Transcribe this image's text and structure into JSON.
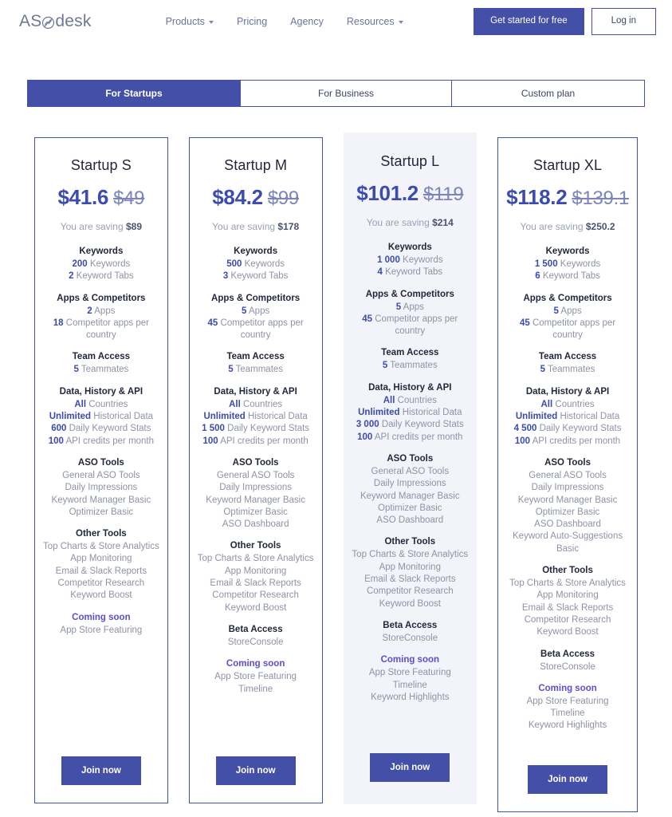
{
  "header": {
    "logo_text_1": "AS",
    "logo_mark": "chart-circle-icon",
    "logo_text_2": "desk",
    "nav": [
      {
        "label": "Products",
        "has_caret": true
      },
      {
        "label": "Pricing",
        "has_caret": false
      },
      {
        "label": "Agency",
        "has_caret": false
      },
      {
        "label": "Resources",
        "has_caret": true
      }
    ],
    "cta_primary": "Get started for free",
    "cta_secondary": "Log in"
  },
  "tabs": [
    {
      "label": "For Startups",
      "active": true
    },
    {
      "label": "For Business",
      "active": false
    },
    {
      "label": "Custom plan",
      "active": false
    }
  ],
  "colors": {
    "accent": "#4450a8",
    "price_new": "#3b4bb0",
    "price_old": "#7b84bd",
    "coming_soon": "#5b4fce",
    "highlight_bg": "#f2f4f9",
    "muted_text": "#8d93a6"
  },
  "cta_label": "Join now",
  "plans": [
    {
      "name": "Startup S",
      "price_new": "$41.6",
      "price_old": "$49",
      "saving_prefix": "You are saving ",
      "saving_amount": "$89",
      "highlight": false,
      "groups": [
        {
          "title": "Keywords",
          "items": [
            {
              "bold": "200",
              "rest": " Keywords"
            },
            {
              "bold": "2",
              "rest": " Keyword Tabs"
            }
          ]
        },
        {
          "title": "Apps & Competitors",
          "items": [
            {
              "bold": "2",
              "rest": " Apps"
            },
            {
              "bold": "18",
              "rest": " Competitor apps per country"
            }
          ]
        },
        {
          "title": "Team Access",
          "items": [
            {
              "bold": "5",
              "rest": " Teammates"
            }
          ]
        },
        {
          "title": "Data, History & API",
          "items": [
            {
              "bold": "All",
              "rest": " Countries"
            },
            {
              "bold": "Unlimited",
              "rest": " Historical Data"
            },
            {
              "bold": "600",
              "rest": " Daily Keyword Stats"
            },
            {
              "bold": "100",
              "rest": " API credits per month"
            }
          ]
        },
        {
          "title": "ASO Tools",
          "items": [
            {
              "bold": "",
              "rest": "General ASO Tools"
            },
            {
              "bold": "",
              "rest": "Daily Impressions"
            },
            {
              "bold": "",
              "rest": "Keyword Manager Basic"
            },
            {
              "bold": "",
              "rest": "Optimizer Basic"
            }
          ]
        },
        {
          "title": "Other Tools",
          "items": [
            {
              "bold": "",
              "rest": "Top Charts & Store Analytics"
            },
            {
              "bold": "",
              "rest": "App Monitoring"
            },
            {
              "bold": "",
              "rest": "Email & Slack Reports"
            },
            {
              "bold": "",
              "rest": "Competitor Research"
            },
            {
              "bold": "",
              "rest": "Keyword Boost"
            }
          ]
        },
        {
          "title": "Coming soon",
          "coming": true,
          "items": [
            {
              "bold": "",
              "rest": "App Store Featuring"
            }
          ]
        }
      ]
    },
    {
      "name": "Startup M",
      "price_new": "$84.2",
      "price_old": "$99",
      "saving_prefix": "You are saving ",
      "saving_amount": "$178",
      "highlight": false,
      "groups": [
        {
          "title": "Keywords",
          "items": [
            {
              "bold": "500",
              "rest": " Keywords"
            },
            {
              "bold": "3",
              "rest": " Keyword Tabs"
            }
          ]
        },
        {
          "title": "Apps & Competitors",
          "items": [
            {
              "bold": "5",
              "rest": " Apps"
            },
            {
              "bold": "45",
              "rest": " Competitor apps per country"
            }
          ]
        },
        {
          "title": "Team Access",
          "items": [
            {
              "bold": "5",
              "rest": " Teammates"
            }
          ]
        },
        {
          "title": "Data, History & API",
          "items": [
            {
              "bold": "All",
              "rest": " Countries"
            },
            {
              "bold": "Unlimited",
              "rest": " Historical Data"
            },
            {
              "bold": "1 500",
              "rest": " Daily Keyword Stats"
            },
            {
              "bold": "100",
              "rest": " API credits per month"
            }
          ]
        },
        {
          "title": "ASO Tools",
          "items": [
            {
              "bold": "",
              "rest": "General ASO Tools"
            },
            {
              "bold": "",
              "rest": "Daily Impressions"
            },
            {
              "bold": "",
              "rest": "Keyword Manager Basic"
            },
            {
              "bold": "",
              "rest": "Optimizer Basic"
            },
            {
              "bold": "",
              "rest": "ASO Dashboard"
            }
          ]
        },
        {
          "title": "Other Tools",
          "items": [
            {
              "bold": "",
              "rest": "Top Charts & Store Analytics"
            },
            {
              "bold": "",
              "rest": "App Monitoring"
            },
            {
              "bold": "",
              "rest": "Email & Slack Reports"
            },
            {
              "bold": "",
              "rest": "Competitor Research"
            },
            {
              "bold": "",
              "rest": "Keyword Boost"
            }
          ]
        },
        {
          "title": "Beta Access",
          "items": [
            {
              "bold": "",
              "rest": "StoreConsole"
            }
          ]
        },
        {
          "title": "Coming soon",
          "coming": true,
          "items": [
            {
              "bold": "",
              "rest": "App Store Featuring"
            },
            {
              "bold": "",
              "rest": "Timeline"
            }
          ]
        }
      ]
    },
    {
      "name": "Startup L",
      "price_new": "$101.2",
      "price_old": "$119",
      "saving_prefix": "You are saving ",
      "saving_amount": "$214",
      "highlight": true,
      "groups": [
        {
          "title": "Keywords",
          "items": [
            {
              "bold": "1 000",
              "rest": " Keywords"
            },
            {
              "bold": "4",
              "rest": " Keyword Tabs"
            }
          ]
        },
        {
          "title": "Apps & Competitors",
          "items": [
            {
              "bold": "5",
              "rest": " Apps"
            },
            {
              "bold": "45",
              "rest": " Competitor apps per country"
            }
          ]
        },
        {
          "title": "Team Access",
          "items": [
            {
              "bold": "5",
              "rest": " Teammates"
            }
          ]
        },
        {
          "title": "Data, History & API",
          "items": [
            {
              "bold": "All",
              "rest": " Countries"
            },
            {
              "bold": "Unlimited",
              "rest": " Historical Data"
            },
            {
              "bold": "3 000",
              "rest": " Daily Keyword Stats"
            },
            {
              "bold": "100",
              "rest": " API credits per month"
            }
          ]
        },
        {
          "title": "ASO Tools",
          "items": [
            {
              "bold": "",
              "rest": "General ASO Tools"
            },
            {
              "bold": "",
              "rest": "Daily Impressions"
            },
            {
              "bold": "",
              "rest": "Keyword Manager Basic"
            },
            {
              "bold": "",
              "rest": "Optimizer Basic"
            },
            {
              "bold": "",
              "rest": "ASO Dashboard"
            }
          ]
        },
        {
          "title": "Other Tools",
          "items": [
            {
              "bold": "",
              "rest": "Top Charts & Store Analytics"
            },
            {
              "bold": "",
              "rest": "App Monitoring"
            },
            {
              "bold": "",
              "rest": "Email & Slack Reports"
            },
            {
              "bold": "",
              "rest": "Competitor Research"
            },
            {
              "bold": "",
              "rest": "Keyword Boost"
            }
          ]
        },
        {
          "title": "Beta Access",
          "items": [
            {
              "bold": "",
              "rest": "StoreConsole"
            }
          ]
        },
        {
          "title": "Coming soon",
          "coming": true,
          "items": [
            {
              "bold": "",
              "rest": "App Store Featuring"
            },
            {
              "bold": "",
              "rest": "Timeline"
            },
            {
              "bold": "",
              "rest": "Keyword Highlights"
            }
          ]
        }
      ]
    },
    {
      "name": "Startup XL",
      "price_new": "$118.2",
      "price_old": "$139.1",
      "saving_prefix": "You are saving ",
      "saving_amount": "$250.2",
      "highlight": false,
      "groups": [
        {
          "title": "Keywords",
          "items": [
            {
              "bold": "1 500",
              "rest": " Keywords"
            },
            {
              "bold": "6",
              "rest": " Keyword Tabs"
            }
          ]
        },
        {
          "title": "Apps & Competitors",
          "items": [
            {
              "bold": "5",
              "rest": " Apps"
            },
            {
              "bold": "45",
              "rest": " Competitor apps per country"
            }
          ]
        },
        {
          "title": "Team Access",
          "items": [
            {
              "bold": "5",
              "rest": " Teammates"
            }
          ]
        },
        {
          "title": "Data, History & API",
          "items": [
            {
              "bold": "All",
              "rest": " Countries"
            },
            {
              "bold": "Unlimited",
              "rest": " Historical Data"
            },
            {
              "bold": "4 500",
              "rest": " Daily Keyword Stats"
            },
            {
              "bold": "100",
              "rest": " API credits per month"
            }
          ]
        },
        {
          "title": "ASO Tools",
          "items": [
            {
              "bold": "",
              "rest": "General ASO Tools"
            },
            {
              "bold": "",
              "rest": "Daily Impressions"
            },
            {
              "bold": "",
              "rest": "Keyword Manager Basic"
            },
            {
              "bold": "",
              "rest": "Optimizer Basic"
            },
            {
              "bold": "",
              "rest": "ASO Dashboard"
            },
            {
              "bold": "",
              "rest": "Keyword Auto-Suggestions Basic"
            }
          ]
        },
        {
          "title": "Other Tools",
          "items": [
            {
              "bold": "",
              "rest": "Top Charts & Store Analytics"
            },
            {
              "bold": "",
              "rest": "App Monitoring"
            },
            {
              "bold": "",
              "rest": "Email & Slack Reports"
            },
            {
              "bold": "",
              "rest": "Competitor Research"
            },
            {
              "bold": "",
              "rest": "Keyword Boost"
            }
          ]
        },
        {
          "title": "Beta Access",
          "items": [
            {
              "bold": "",
              "rest": "StoreConsole"
            }
          ]
        },
        {
          "title": "Coming soon",
          "coming": true,
          "items": [
            {
              "bold": "",
              "rest": "App Store Featuring"
            },
            {
              "bold": "",
              "rest": "Timeline"
            },
            {
              "bold": "",
              "rest": "Keyword Highlights"
            }
          ]
        }
      ]
    }
  ]
}
